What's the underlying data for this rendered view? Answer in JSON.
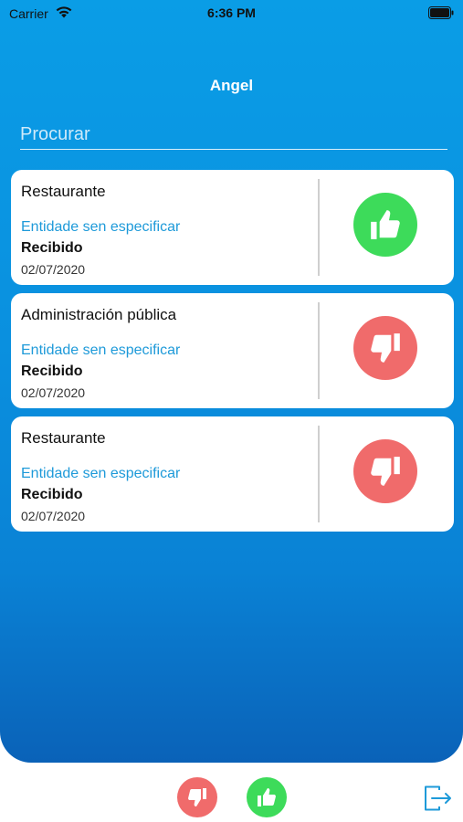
{
  "status_bar": {
    "carrier": "Carrier",
    "time": "6:36 PM"
  },
  "header": {
    "title": "Angel"
  },
  "search": {
    "placeholder": "Procurar"
  },
  "cards": [
    {
      "category": "Restaurante",
      "entity": "Entidade sen especificar",
      "status": "Recibido",
      "date": "02/07/2020",
      "rating": "thumbs-up-icon"
    },
    {
      "category": "Administración pública",
      "entity": "Entidade sen especificar",
      "status": "Recibido",
      "date": "02/07/2020",
      "rating": "thumbs-down-icon"
    },
    {
      "category": "Restaurante",
      "entity": "Entidade sen especificar",
      "status": "Recibido",
      "date": "02/07/2020",
      "rating": "thumbs-down-icon"
    }
  ],
  "bottom_bar": {
    "left_icon": "thumbs-down-icon",
    "middle_icon": "thumbs-up-icon",
    "right_icon": "logout-icon"
  },
  "colors": {
    "accent": "#0a9de6",
    "positive": "#3ddb5a",
    "negative": "#f06b6b",
    "entity_text": "#1e9ad9"
  }
}
